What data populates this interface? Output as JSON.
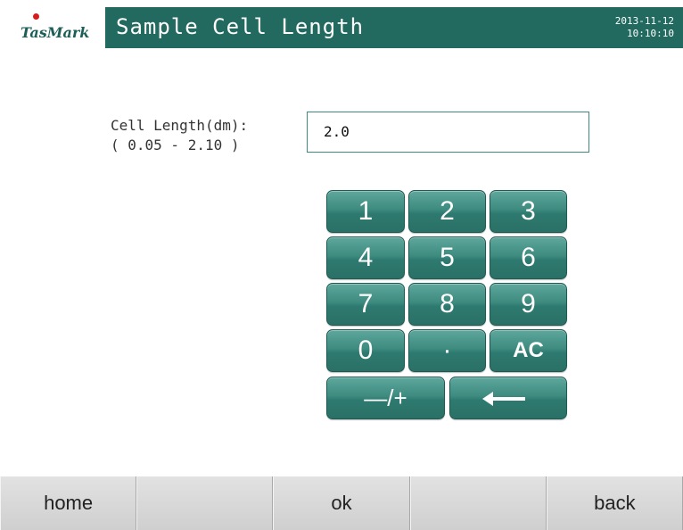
{
  "header": {
    "logo_text": "TasMark",
    "title": "Sample Cell Length",
    "date": "2013-11-12",
    "time": "10:10:10"
  },
  "form": {
    "label_line1": "Cell Length(dm):",
    "label_line2": "( 0.05 - 2.10 )",
    "value": "2.0"
  },
  "keypad": {
    "k1": "1",
    "k2": "2",
    "k3": "3",
    "k4": "4",
    "k5": "5",
    "k6": "6",
    "k7": "7",
    "k8": "8",
    "k9": "9",
    "k0": "0",
    "dot": "·",
    "clear": "AC",
    "sign": "—/+"
  },
  "nav": {
    "home": "home",
    "blank1": "",
    "ok": "ok",
    "blank2": "",
    "back": "back"
  },
  "colors": {
    "accent": "#226a5f",
    "key": "#3e8b80",
    "logo_dot": "#d81b1b"
  }
}
